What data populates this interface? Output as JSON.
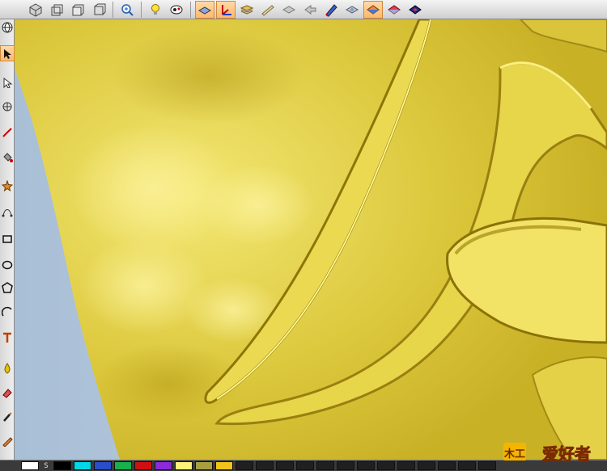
{
  "toolbar": {
    "buttons": [
      {
        "icon": "cube-iso-icon",
        "active": false
      },
      {
        "icon": "cube-wire-icon",
        "active": false
      },
      {
        "icon": "cube-front-icon",
        "active": false
      },
      {
        "icon": "cube-side-icon",
        "active": false
      },
      {
        "icon": "zoom-icon",
        "active": false
      },
      {
        "icon": "light-bulb-icon",
        "active": false
      },
      {
        "icon": "paint-icon",
        "active": false
      },
      {
        "icon": "plane-layer-icon",
        "active": true
      },
      {
        "icon": "axes-icon",
        "active": true
      },
      {
        "icon": "stack-layers-icon",
        "active": false
      },
      {
        "icon": "bar-icon",
        "active": false
      },
      {
        "icon": "flat-diamond-icon",
        "active": false
      },
      {
        "icon": "arrow-left-icon",
        "active": false
      },
      {
        "icon": "pen-tool-icon",
        "active": false
      },
      {
        "icon": "relief-diamond-icon",
        "active": false
      },
      {
        "icon": "shaded-diamond-icon",
        "active": true
      },
      {
        "icon": "red-diamond-icon",
        "active": false
      },
      {
        "icon": "blue-diamond-icon",
        "active": false
      }
    ]
  },
  "lefttools": {
    "tools": [
      {
        "icon": "globe-icon",
        "active": false
      },
      {
        "icon": "select-arrow-icon",
        "active": true
      },
      {
        "icon": "node-arrow-icon",
        "active": false
      },
      {
        "icon": "transform-icon",
        "active": false
      },
      {
        "icon": "line-pen-icon",
        "active": false
      },
      {
        "icon": "paint-bucket-icon",
        "active": false
      },
      {
        "icon": "star-tool-icon",
        "active": false
      },
      {
        "icon": "bezier-icon",
        "active": false
      },
      {
        "icon": "rectangle-icon",
        "active": false
      },
      {
        "icon": "ellipse-icon",
        "active": false
      },
      {
        "icon": "polygon-icon",
        "active": false
      },
      {
        "icon": "arc-icon",
        "active": false
      },
      {
        "icon": "text-tool-icon",
        "active": false
      },
      {
        "icon": "droplet-icon",
        "active": false
      },
      {
        "icon": "eraser-icon",
        "active": false
      },
      {
        "icon": "brush-icon",
        "active": false
      },
      {
        "icon": "pencil-icon",
        "active": false
      }
    ]
  },
  "palette": {
    "label": "S",
    "colors": [
      "#ffffff",
      "#000000",
      "#00d8e8",
      "#2a4ec8",
      "#16b04c",
      "#d01010",
      "#8a2ad8",
      "#fff27a",
      "#a8a040",
      "#f0c418",
      "#202020",
      "#202020",
      "#202020",
      "#202020",
      "#202020",
      "#202020",
      "#202020",
      "#202020",
      "#202020",
      "#202020",
      "#202020",
      "#202020",
      "#202020"
    ]
  },
  "watermark": {
    "text": "爱好者",
    "mark": "木工"
  },
  "colors": {
    "relief_base": "#e3cf42",
    "relief_shadow": "#a88f12",
    "relief_highlight": "#f7ec7a",
    "background": "#b9cadd"
  }
}
